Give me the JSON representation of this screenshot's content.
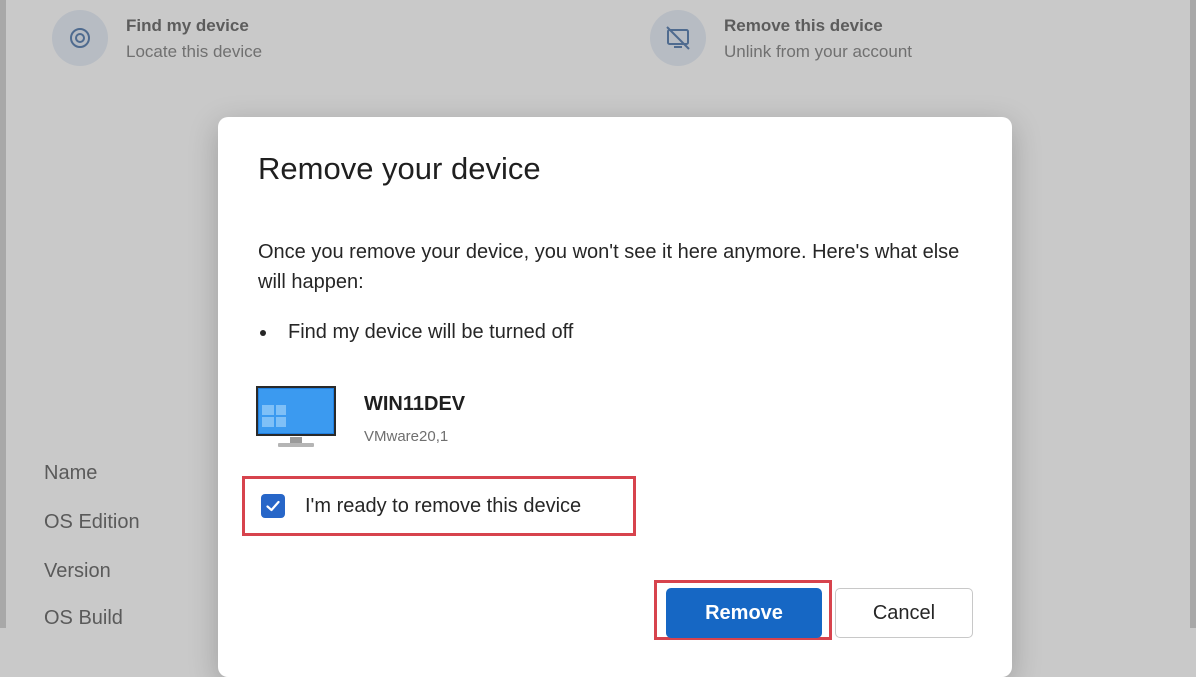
{
  "background": {
    "actions": [
      {
        "title": "Find my device",
        "subtitle": "Locate this device",
        "icon": "location-target-icon"
      },
      {
        "title": "Remove this device",
        "subtitle": "Unlink from your account",
        "icon": "device-unlink-icon"
      }
    ],
    "labels": [
      "Name",
      "OS Edition",
      "Version",
      "OS Build"
    ]
  },
  "dialog": {
    "title": "Remove your device",
    "body": "Once you remove your device, you won't see it here anymore. Here's what else will happen:",
    "bullets": [
      "Find my device will be turned off"
    ],
    "device": {
      "name": "WIN11DEV",
      "model": "VMware20,1",
      "icon": "desktop-monitor-icon"
    },
    "checkbox": {
      "label": "I'm ready to remove this device",
      "checked": true
    },
    "buttons": {
      "remove": "Remove",
      "cancel": "Cancel"
    }
  },
  "colors": {
    "accent": "#1667c4",
    "highlight": "#d7434d",
    "checkbox": "#2766c8"
  }
}
